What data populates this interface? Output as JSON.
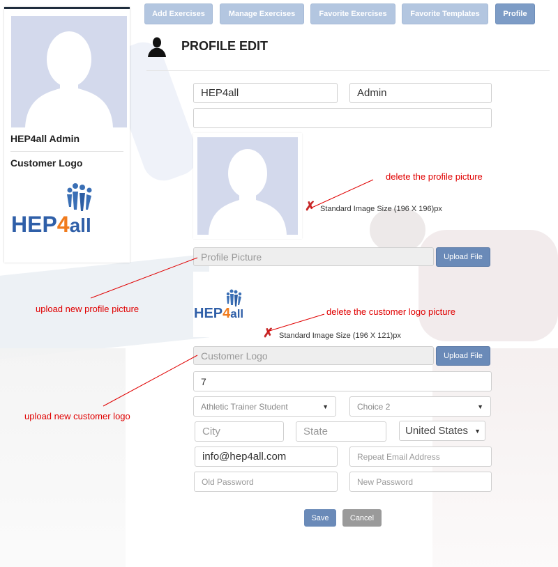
{
  "nav": {
    "items": [
      {
        "label": "Add Exercises"
      },
      {
        "label": "Manage Exercises"
      },
      {
        "label": "Favorite Exercises"
      },
      {
        "label": "Favorite Templates"
      },
      {
        "label": "Profile"
      }
    ],
    "active": "Profile"
  },
  "sidebar": {
    "name": "HEP4all Admin",
    "logo_label": "Customer Logo",
    "logo_text": "HEP4all"
  },
  "header": {
    "title": "PROFILE EDIT",
    "icon": "user-icon"
  },
  "form": {
    "first_name": "HEP4all",
    "last_name": "Admin",
    "extra": "",
    "profile_picture_placeholder": "Profile Picture",
    "upload_label": "Upload File",
    "profile_size_note": "Standard Image Size (196 X 196)px",
    "logo_size_note": "Standard Image Size (196 X 121)px",
    "customer_logo_placeholder": "Customer Logo",
    "number_value": "7",
    "occupation": "Athletic Trainer Student",
    "choice": "Choice 2",
    "city_placeholder": "City",
    "state_placeholder": "State",
    "country": "United States",
    "email": "info@hep4all.com",
    "repeat_email_placeholder": "Repeat Email Address",
    "old_password_placeholder": "Old Password",
    "new_password_placeholder": "New Password",
    "save_label": "Save",
    "cancel_label": "Cancel"
  },
  "annotations": {
    "delete_profile": "delete the profile picture",
    "upload_profile": "upload new profile picture",
    "delete_logo": "delete the customer logo picture",
    "upload_logo": "upload new customer logo"
  },
  "colors": {
    "nav_button": "#b3c6e0",
    "nav_active": "#7d9cc6",
    "primary_button": "#6a8ab8",
    "cancel_button": "#9a9a9a",
    "annotation": "#e00000",
    "delete_icon": "#c62828",
    "avatar_bg": "#d3d9ec"
  }
}
